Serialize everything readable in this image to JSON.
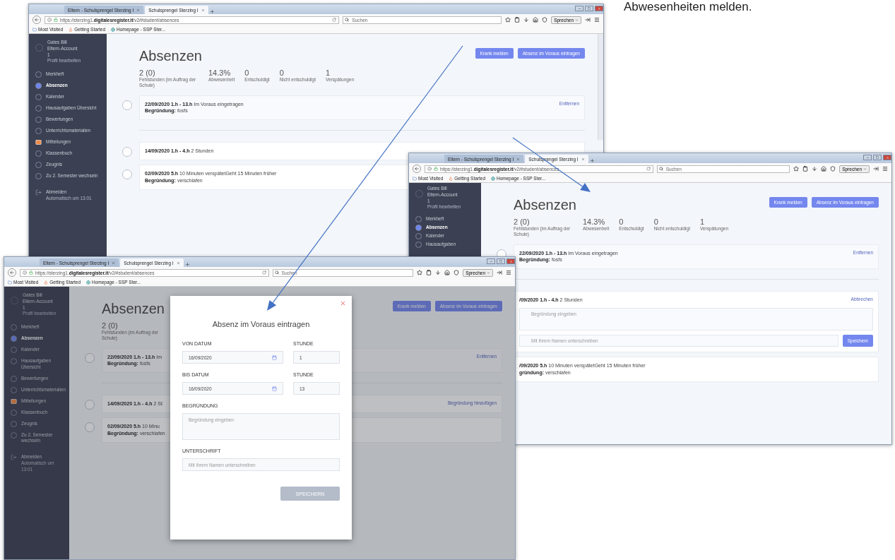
{
  "slide_caption": "Abwesenheiten melden.",
  "windows": [
    {
      "tabs": [
        {
          "label": "Eltern - Schulsprengel Sterzing I",
          "selected": false
        },
        {
          "label": "Schulsprengel Sterzing I",
          "selected": true
        }
      ],
      "url": "https://sterzing1.**digitalesregister.it**/v2/#student/absences",
      "search": {
        "placeholder": "Suchen"
      },
      "speak_button": "Sprechen",
      "bookmarks": [
        "Most Visited",
        "Getting Started",
        "Homepage - SSP Ster..."
      ],
      "sidebar": {
        "profile": {
          "name": "Gates Bill",
          "role": "Eltern-Account",
          "number": "1",
          "edit": "Profil bearbeiten"
        },
        "items": [
          {
            "label": "Merkheft",
            "kind": "radio",
            "selected": false
          },
          {
            "label": "Absenzen",
            "kind": "radio",
            "selected": true
          },
          {
            "label": "Kalender",
            "kind": "radio",
            "selected": false
          },
          {
            "label": "Hausaufgaben Übersicht",
            "kind": "radio",
            "selected": false
          },
          {
            "label": "Bewertungen",
            "kind": "radio",
            "selected": false
          },
          {
            "label": "Unterrichtsmaterialien",
            "kind": "radio",
            "selected": false
          },
          {
            "label": "Mitteilungen",
            "kind": "mail",
            "selected": false
          },
          {
            "label": "Klassenbuch",
            "kind": "radio",
            "selected": false
          },
          {
            "label": "Zeugnis",
            "kind": "radio",
            "selected": false
          },
          {
            "label": "Zu 2. Semester wechseln",
            "kind": "radio",
            "selected": false
          }
        ],
        "logout": {
          "label": "Abmelden",
          "note": "Automatisch um 13:01"
        }
      },
      "title": "Absenzen",
      "buttons": [
        "Krank melden",
        "Absenz im Voraus eintragen"
      ],
      "stats": [
        {
          "value": "2 (0)",
          "label": "Fehlstunden (im Auftrag der Schule)"
        },
        {
          "value": "14.3%",
          "label": "Abwesenheit"
        },
        {
          "value": "0",
          "label": "Entschuldigt"
        },
        {
          "value": "0",
          "label": "Nicht entschuldigt"
        },
        {
          "value": "1",
          "label": "Verspätungen"
        }
      ],
      "upcoming": [
        {
          "line": "**22/09/2020 1.h - 13.h** Im Voraus eingetragen",
          "reason": "**Begründung:** fosfs",
          "action": "Entfernen"
        }
      ],
      "past": [
        {
          "line": "**14/09/2020 1.h - 4.h** 2 Stunden"
        },
        {
          "line": "**02/09/2020 5.h** 10 Minuten verspätetGeht 15 Minuten früher",
          "reason": "**Begründung:** verschlafen"
        }
      ]
    },
    {
      "tabs": [
        {
          "label": "Eltern - Schulsprengel Sterzing I",
          "selected": false
        },
        {
          "label": "Schulsprengel Sterzing I",
          "selected": true
        }
      ],
      "url": "https://sterzing1.**digitalesregister.it**/v2/#student/absences",
      "search": {
        "placeholder": "Suchen"
      },
      "speak_button": "Sprechen",
      "bookmarks": [
        "Most Visited",
        "Getting Started",
        "Homepage - SSP Ster..."
      ],
      "sidebar": {
        "profile": {
          "name": "Gates Bill",
          "role": "Eltern-Account",
          "number": "1",
          "edit": "Profil bearbeiten"
        },
        "items": [
          {
            "label": "Merkheft",
            "kind": "radio",
            "selected": false
          },
          {
            "label": "Absenzen",
            "kind": "radio",
            "selected": true
          },
          {
            "label": "Kalender",
            "kind": "radio",
            "selected": false
          },
          {
            "label": "Hausaufgaben",
            "kind": "radio",
            "selected": false
          }
        ]
      },
      "title": "Absenzen",
      "buttons": [
        "Krank melden",
        "Absenz im Voraus eintragen"
      ],
      "stats": [
        {
          "value": "2 (0)",
          "label": "Fehlstunden (im Auftrag der Schule)"
        },
        {
          "value": "14.3%",
          "label": "Abwesenheit"
        },
        {
          "value": "0",
          "label": "Entschuldigt"
        },
        {
          "value": "0",
          "label": "Nicht entschuldigt"
        },
        {
          "value": "1",
          "label": "Verspätungen"
        }
      ],
      "upcoming": [
        {
          "line": "**22/09/2020 1.h - 13.h** Im Voraus eingetragen",
          "reason": "**Begründung:** fosfs",
          "action": "Entfernen"
        }
      ],
      "past": [
        {
          "line": "**/09/2020 1.h - 4.h** 2 Stunden",
          "action": "Abbrechen",
          "form": {
            "reason_placeholder": "Begründung eingeben",
            "signature_placeholder": "Mit Ihrem Namen unterschreiben",
            "save": "Speichern"
          }
        },
        {
          "line": "**/09/2020 5.h** 10 Minuten verspätetGeht 15 Minuten früher",
          "reason": "**gründung:** verschlafen"
        }
      ]
    },
    {
      "tabs": [
        {
          "label": "Eltern - Schulsprengel Sterzing I",
          "selected": false
        },
        {
          "label": "Schulsprengel Sterzing I",
          "selected": true
        }
      ],
      "url": "https://sterzing1.**digitalesregister.it**/v2/#student/absences",
      "search": {
        "placeholder": "Suchen"
      },
      "speak_button": "Sprechen",
      "bookmarks": [
        "Most Visited",
        "Getting Started",
        "Homepage - SSP Ster..."
      ],
      "sidebar": {
        "profile": {
          "name": "Gates Bill",
          "role": "Eltern-Account",
          "number": "1",
          "edit": "Profil bearbeiten"
        },
        "items": [
          {
            "label": "Merkheft",
            "kind": "radio",
            "selected": false
          },
          {
            "label": "Absenzen",
            "kind": "radio",
            "selected": true
          },
          {
            "label": "Kalender",
            "kind": "radio",
            "selected": false
          },
          {
            "label": "Hausaufgaben Übersicht",
            "kind": "radio",
            "selected": false
          },
          {
            "label": "Bewertungen",
            "kind": "radio",
            "selected": false
          },
          {
            "label": "Unterrichtsmaterialien",
            "kind": "radio",
            "selected": false
          },
          {
            "label": "Mitteilungen",
            "kind": "mail",
            "selected": false
          },
          {
            "label": "Klassenbuch",
            "kind": "radio",
            "selected": false
          },
          {
            "label": "Zeugnis",
            "kind": "radio",
            "selected": false
          },
          {
            "label": "Zu 2. Semester wechseln",
            "kind": "radio",
            "selected": false
          }
        ],
        "logout": {
          "label": "Abmelden",
          "note": "Automatisch um 13:01"
        }
      },
      "title": "Absenzen",
      "buttons": [
        "Krank melden",
        "Absenz im Voraus eintragen"
      ],
      "stats": [
        {
          "value": "2 (0)",
          "label": "Fehlstunden (im Auftrag der Schule)"
        }
      ],
      "upcoming": [
        {
          "line": "**22/09/2020 1.h - 13.h** Im",
          "reason": "**Begründung:** fosfs",
          "action": "Entfernen"
        }
      ],
      "past": [
        {
          "line": "**14/09/2020 1.h - 4.h** 2 St",
          "action": "Begründung hinzufügen"
        },
        {
          "line": "**02/09/2020 5.h** 10 Minu",
          "reason": "**Begründung:** verschlafen"
        }
      ],
      "modal": {
        "title": "Absenz im Voraus eintragen",
        "fields": [
          {
            "label": "VON DATUM",
            "value": "16/09/2020",
            "kind": "date"
          },
          {
            "label": "STUNDE",
            "value": "1",
            "kind": "text"
          },
          {
            "label": "BIS DATUM",
            "value": "16/09/2020",
            "kind": "date"
          },
          {
            "label": "STUNDE",
            "value": "13",
            "kind": "text"
          },
          {
            "label": "BEGRÜNDUNG",
            "placeholder": "Begründung eingeben",
            "kind": "textarea"
          },
          {
            "label": "UNTERSCHRIFT",
            "placeholder": "Mit Ihrem Namen unterschreiben",
            "kind": "text"
          }
        ],
        "save": {
          "label": "SPEICHERN",
          "disabled": true
        }
      }
    }
  ]
}
